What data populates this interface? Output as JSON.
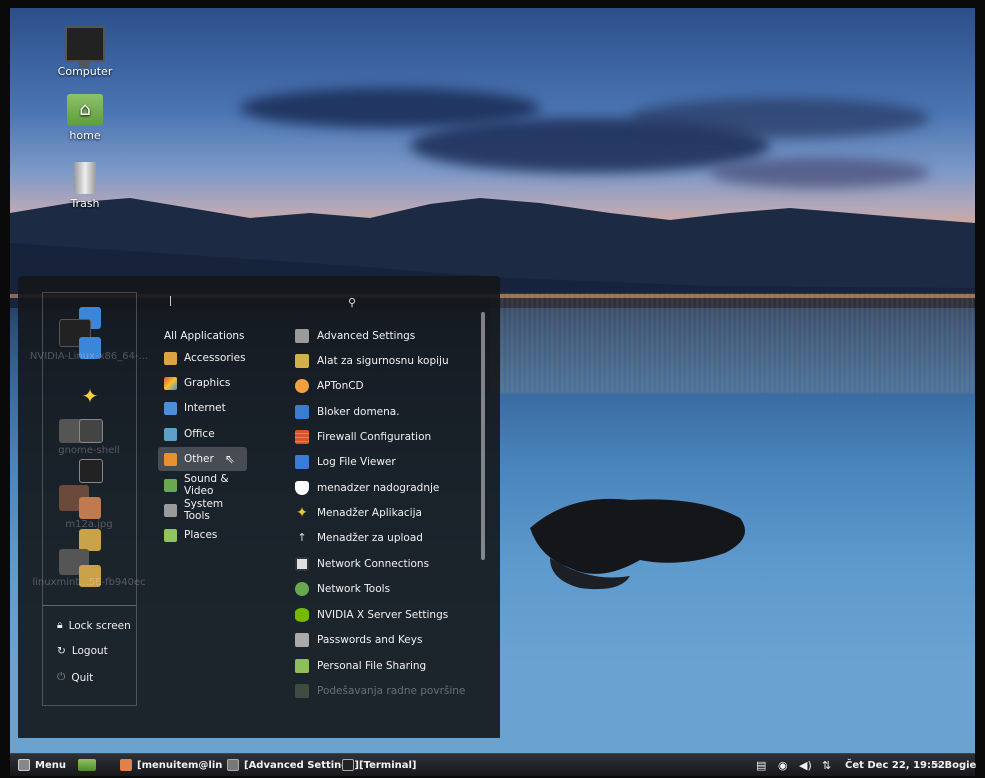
{
  "desktop": {
    "icons": [
      {
        "label": "Computer",
        "icon": "computer-icon"
      },
      {
        "label": "home",
        "icon": "home-folder-icon"
      },
      {
        "label": "Trash",
        "icon": "trash-icon"
      }
    ]
  },
  "menu": {
    "favorites_ghost_labels": [
      "NVIDIA-Linux-x86_64-...",
      "gnome-shell",
      "m12a.jpg",
      "linuxmint...5E-fb940ec"
    ],
    "session": {
      "lock": "Lock screen",
      "logout": "Logout",
      "quit": "Quit"
    },
    "search": {
      "value": "",
      "icon": "search-icon"
    },
    "categories": [
      {
        "label": "All Applications",
        "icon": null
      },
      {
        "label": "Accessories",
        "icon": "accessories-icon",
        "color": "#d9a441"
      },
      {
        "label": "Graphics",
        "icon": "graphics-icon",
        "color": "#e0504a"
      },
      {
        "label": "Internet",
        "icon": "internet-icon",
        "color": "#4d8fd6"
      },
      {
        "label": "Office",
        "icon": "office-icon",
        "color": "#5fa0c9"
      },
      {
        "label": "Other",
        "icon": "other-icon",
        "color": "#e8902e",
        "active": true
      },
      {
        "label": "Sound & Video",
        "icon": "sound-video-icon",
        "color": "#6aa84f"
      },
      {
        "label": "System Tools",
        "icon": "system-tools-icon",
        "color": "#9a9a9a"
      },
      {
        "label": "Places",
        "icon": "places-folder-icon",
        "color": "#8fc45e"
      }
    ],
    "apps": [
      {
        "label": "Advanced Settings",
        "color": "#9a9a9a"
      },
      {
        "label": "Alat za sigurnosnu kopiju",
        "color": "#d2b04a"
      },
      {
        "label": "APTonCD",
        "color": "#f0a03c"
      },
      {
        "label": "Bloker domena.",
        "color": "#3b7bd0"
      },
      {
        "label": "Firewall Configuration",
        "color": "#d9532c"
      },
      {
        "label": "Log File Viewer",
        "color": "#3c7ad8"
      },
      {
        "label": "menadzer nadogradnje",
        "color": "#ffffff"
      },
      {
        "label": "Menadžer Aplikacija",
        "color": "#f4c430"
      },
      {
        "label": "Menadžer za upload",
        "color": "#cccccc"
      },
      {
        "label": "Network Connections",
        "color": "#e0e0e0"
      },
      {
        "label": "Network Tools",
        "color": "#6aa84f"
      },
      {
        "label": "NVIDIA X Server Settings",
        "color": "#76b900"
      },
      {
        "label": "Passwords and Keys",
        "color": "#aaaaaa"
      },
      {
        "label": "Personal File Sharing",
        "color": "#8fbf5a"
      },
      {
        "label": "Podešavanja radne površine",
        "color": "#7a9a6a"
      }
    ]
  },
  "taskbar": {
    "menu_label": "Menu",
    "windows": [
      {
        "label": "[menuitem@linuxmi...",
        "icon": "text-editor-icon"
      },
      {
        "label": "[Advanced Settings]",
        "icon": "advanced-settings-icon"
      },
      {
        "label": "[Terminal]",
        "icon": "terminal-icon"
      }
    ],
    "clock": "Čet Dec 22, 19:52",
    "user": "Bogie"
  },
  "colors": {
    "menu_bg": "#14161a",
    "taskbar_bg": "#1f2226",
    "accent_selected": "#ffffff33"
  }
}
